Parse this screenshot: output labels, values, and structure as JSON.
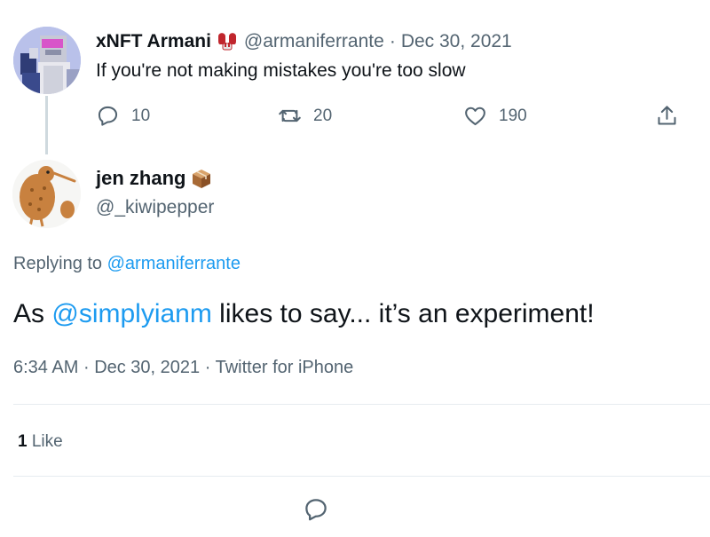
{
  "parent_tweet": {
    "author_name": "xNFT Armani",
    "author_badge_icon": "fighting-gloves-icon",
    "author_handle": "@armaniferrante",
    "separator": "·",
    "date": "Dec 30, 2021",
    "text": "If you're not making mistakes you're too slow",
    "actions": {
      "reply_count": "10",
      "retweet_count": "20",
      "like_count": "190"
    }
  },
  "reply_tweet": {
    "author_name": "jen zhang",
    "author_badge_icon": "package-box-icon",
    "author_handle": "@_kiwipepper",
    "replying_prefix": "Replying to",
    "replying_to": "@armaniferrante",
    "text_before": "As ",
    "mention": "@simplyianm",
    "text_after": " likes to say... it’s an experiment!",
    "time": "6:34 AM",
    "separator": "·",
    "date": "Dec 30, 2021",
    "source": "Twitter for iPhone",
    "like_count": "1",
    "like_label": "Like"
  },
  "colors": {
    "accent": "#1d9bf0",
    "secondary_text": "#536471",
    "primary_text": "#0f1419",
    "thread_line": "#cfd9de",
    "divider": "#e6ecf0"
  }
}
